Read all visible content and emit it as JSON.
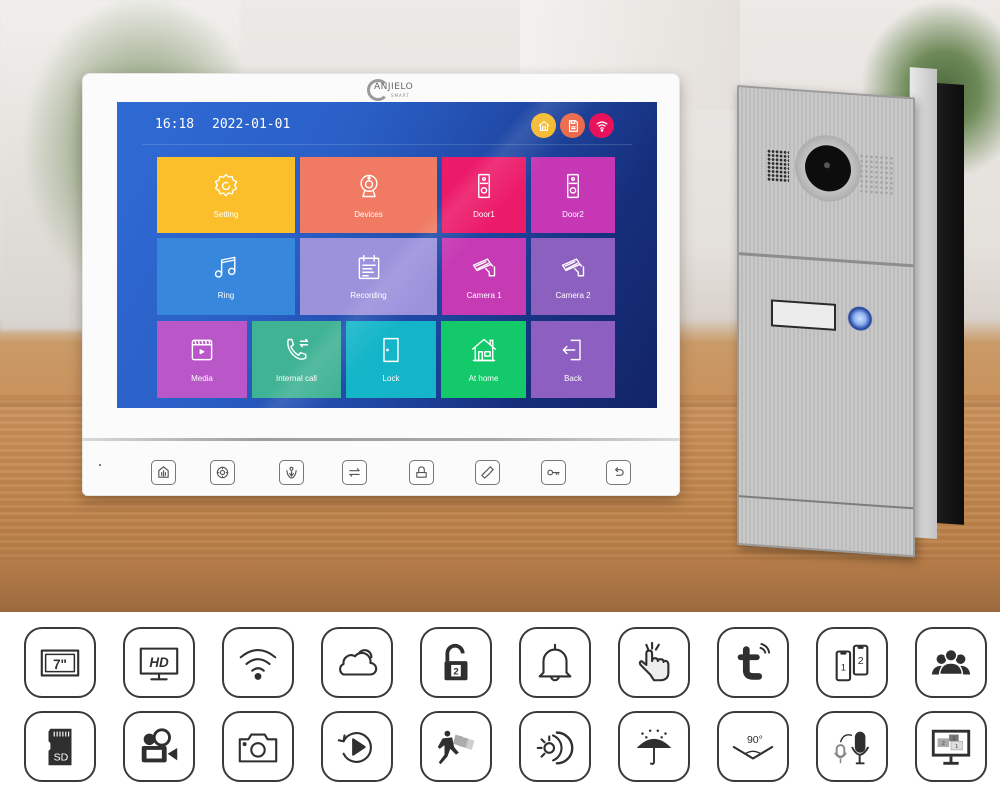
{
  "brand": {
    "logo_text": "ANJIELO",
    "logo_subtext": "SMART"
  },
  "monitor": {
    "status_bar": {
      "time": "16:18",
      "date": "2022-01-01",
      "icons": [
        {
          "name": "home-status-icon",
          "color": "#f5b82c"
        },
        {
          "name": "sd-card-status-icon",
          "color": "#ec6a4c"
        },
        {
          "name": "wifi-status-icon",
          "color": "#e8125c"
        }
      ]
    },
    "tiles": [
      {
        "id": "setting",
        "label": "Setting",
        "icon": "gear-icon",
        "color": "#fbbf2c"
      },
      {
        "id": "devices",
        "label": "Devices",
        "icon": "webcam-icon",
        "color": "#f07a62"
      },
      {
        "id": "door1",
        "label": "Door1",
        "icon": "doorbell-icon",
        "color": "#ec1b6a"
      },
      {
        "id": "door2",
        "label": "Door2",
        "icon": "doorbell-icon",
        "color": "#c537b4"
      },
      {
        "id": "ring",
        "label": "Ring",
        "icon": "music-note-icon",
        "color": "#3787dd"
      },
      {
        "id": "recording",
        "label": "Recording",
        "icon": "calendar-list-icon",
        "color": "#9b92dc"
      },
      {
        "id": "camera1",
        "label": "Camera 1",
        "icon": "cctv-camera-icon",
        "color": "#c63ab4"
      },
      {
        "id": "camera2",
        "label": "Camera 2",
        "icon": "cctv-camera-icon",
        "color": "#8b60be"
      },
      {
        "id": "media",
        "label": "Media",
        "icon": "video-clapper-icon",
        "color": "#b956c8"
      },
      {
        "id": "internal-call",
        "label": "Internal call",
        "icon": "phone-transfer-icon",
        "color": "#41b395"
      },
      {
        "id": "lock",
        "label": "Lock",
        "icon": "door-icon",
        "color": "#14b5c8"
      },
      {
        "id": "at-home",
        "label": "At home",
        "icon": "house-icon",
        "color": "#13c96a"
      },
      {
        "id": "back",
        "label": "Back",
        "icon": "exit-icon",
        "color": "#8c5fc0"
      }
    ],
    "hardware_buttons": [
      {
        "id": "monitor",
        "icon": "monitor-hand-icon"
      },
      {
        "id": "settings",
        "icon": "gear-icon"
      },
      {
        "id": "intercom",
        "icon": "intercom-icon"
      },
      {
        "id": "transfer",
        "icon": "transfer-arrows-icon"
      },
      {
        "id": "lock",
        "icon": "unlock-icon"
      },
      {
        "id": "talk",
        "icon": "phone-handset-icon"
      },
      {
        "id": "key",
        "icon": "key-icon"
      },
      {
        "id": "back",
        "icon": "return-icon"
      }
    ]
  },
  "features": {
    "row1": [
      {
        "name": "screen-7inch-icon",
        "text": "7\""
      },
      {
        "name": "hd-monitor-icon",
        "text": "HD"
      },
      {
        "name": "wifi-icon",
        "text": ""
      },
      {
        "name": "cloud-icon",
        "text": ""
      },
      {
        "name": "dual-unlock-icon",
        "text": "2"
      },
      {
        "name": "bell-icon",
        "text": ""
      },
      {
        "name": "touch-hand-icon",
        "text": ""
      },
      {
        "name": "tuya-app-icon",
        "text": ""
      },
      {
        "name": "two-phones-icon",
        "text_a": "1",
        "text_b": "2"
      },
      {
        "name": "multi-user-icon",
        "text": ""
      }
    ],
    "row2": [
      {
        "name": "sd-card-icon",
        "text": "SD"
      },
      {
        "name": "video-recorder-icon",
        "text": ""
      },
      {
        "name": "camera-snapshot-icon",
        "text": ""
      },
      {
        "name": "playback-icon",
        "text": ""
      },
      {
        "name": "motion-detection-icon",
        "text": ""
      },
      {
        "name": "day-night-icon",
        "text": ""
      },
      {
        "name": "waterproof-icon",
        "text": ""
      },
      {
        "name": "viewing-angle-icon",
        "text": "90°"
      },
      {
        "name": "voice-change-icon",
        "text": ""
      },
      {
        "name": "split-screen-icon",
        "text_a": "2",
        "text_b": "3",
        "text_c": "1"
      }
    ]
  }
}
